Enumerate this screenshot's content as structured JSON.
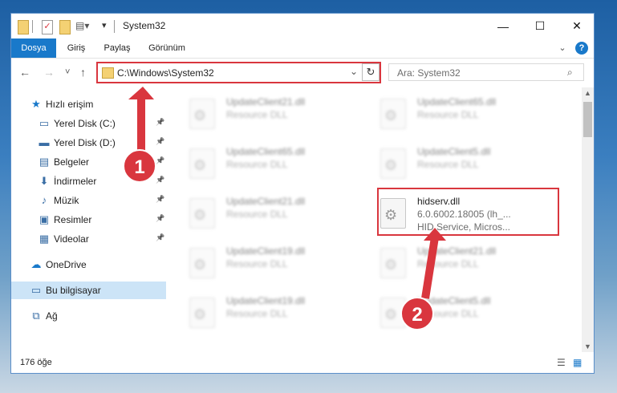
{
  "window": {
    "title": "System32",
    "minimize": "—",
    "maximize": "☐",
    "close": "✕"
  },
  "ribbon": {
    "tabs": [
      "Dosya",
      "Giriş",
      "Paylaş",
      "Görünüm"
    ],
    "collapse": "⌄",
    "help": "?"
  },
  "address": {
    "path": "C:\\Windows\\System32",
    "search_placeholder": "Ara: System32"
  },
  "nav": {
    "back": "←",
    "forward": "→",
    "recent": "˅",
    "up": "↑"
  },
  "sidebar": [
    {
      "label": "Hızlı erişim",
      "icon": "star-icon",
      "glyph": "★",
      "indent": 0
    },
    {
      "label": "Yerel Disk (C:)",
      "icon": "drive-icon",
      "glyph": "▭",
      "indent": 1,
      "pinned": true
    },
    {
      "label": "Yerel Disk (D:)",
      "icon": "drive-icon",
      "glyph": "▬",
      "indent": 1,
      "pinned": true
    },
    {
      "label": "Belgeler",
      "icon": "documents-icon",
      "glyph": "▤",
      "indent": 1,
      "pinned": true
    },
    {
      "label": "İndirmeler",
      "icon": "download-icon",
      "glyph": "⬇",
      "indent": 1,
      "pinned": true
    },
    {
      "label": "Müzik",
      "icon": "music-icon",
      "glyph": "♪",
      "indent": 1,
      "pinned": true
    },
    {
      "label": "Resimler",
      "icon": "pictures-icon",
      "glyph": "▣",
      "indent": 1,
      "pinned": true
    },
    {
      "label": "Videolar",
      "icon": "video-icon",
      "glyph": "▦",
      "indent": 1,
      "pinned": true
    },
    {
      "label": "OneDrive",
      "icon": "cloud-icon",
      "glyph": "☁",
      "indent": 0
    },
    {
      "label": "Bu bilgisayar",
      "icon": "computer-icon",
      "glyph": "▭",
      "indent": 0,
      "selected": true
    },
    {
      "label": "Ağ",
      "icon": "network-icon",
      "glyph": "⧉",
      "indent": 0
    }
  ],
  "files": [
    {
      "name": "UpdateClient21.dll",
      "sub1": "Resource DLL",
      "sub2": "",
      "blurred": true
    },
    {
      "name": "UpdateClient65.dll",
      "sub1": "Resource DLL",
      "sub2": "",
      "blurred": true
    },
    {
      "name": "UpdateClient65.dll",
      "sub1": "Resource DLL",
      "sub2": "",
      "blurred": true
    },
    {
      "name": "UpdateClient5.dll",
      "sub1": "Resource DLL",
      "sub2": "",
      "blurred": true
    },
    {
      "name": "UpdateClient21.dll",
      "sub1": "Resource DLL",
      "sub2": "",
      "blurred": true
    },
    {
      "name": "hidserv.dll",
      "sub1": "6.0.6002.18005 (lh_...",
      "sub2": "HID Service, Micros...",
      "blurred": false
    },
    {
      "name": "UpdateClient19.dll",
      "sub1": "Resource DLL",
      "sub2": "",
      "blurred": true
    },
    {
      "name": "UpdateClient21.dll",
      "sub1": "Resource DLL",
      "sub2": "",
      "blurred": true
    },
    {
      "name": "UpdateClient19.dll",
      "sub1": "Resource DLL",
      "sub2": "",
      "blurred": true
    },
    {
      "name": "UpdateClient5.dll",
      "sub1": "Resource DLL",
      "sub2": "",
      "blurred": true
    }
  ],
  "status": {
    "count": "176 öğe"
  },
  "markers": [
    "1",
    "2"
  ],
  "colors": {
    "accent": "#1979ca",
    "highlight": "#d9363e"
  }
}
